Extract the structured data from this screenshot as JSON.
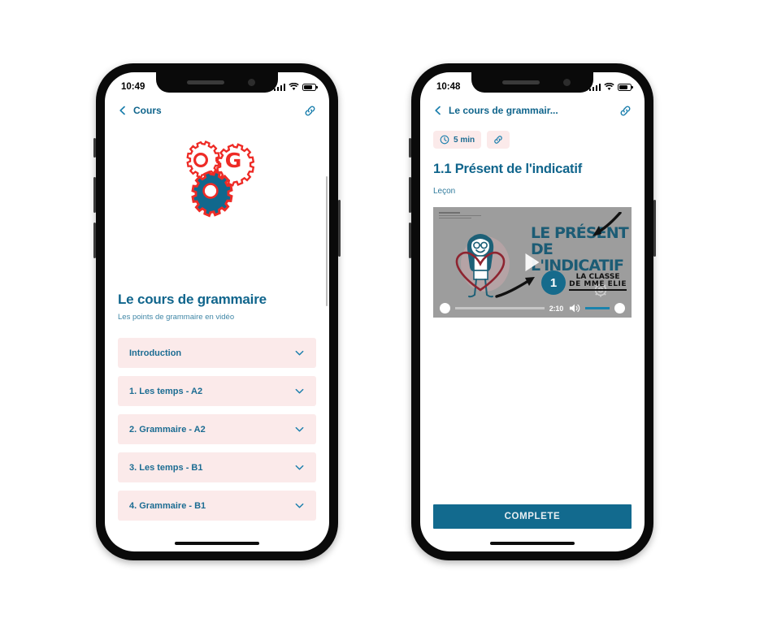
{
  "phones": {
    "left": {
      "status": {
        "time": "10:49",
        "signal_icon": "signal-bars-icon",
        "wifi_icon": "wifi-icon",
        "battery_icon": "battery-icon"
      },
      "nav": {
        "back_icon": "chevron-left-icon",
        "title": "Cours",
        "link_icon": "link-icon"
      },
      "logo": {
        "name": "gears-logo",
        "letter": "G",
        "color_outline": "#ee2b26",
        "color_fill": "#11688d"
      },
      "course": {
        "title": "Le cours de grammaire",
        "subtitle": "Les points de grammaire en vidéo"
      },
      "accordion": [
        {
          "label": "Introduction",
          "chevron": "chevron-down-icon"
        },
        {
          "label": "1. Les temps - A2",
          "chevron": "chevron-down-icon"
        },
        {
          "label": "2. Grammaire - A2",
          "chevron": "chevron-down-icon"
        },
        {
          "label": "3. Les temps  - B1",
          "chevron": "chevron-down-icon"
        },
        {
          "label": "4. Grammaire - B1",
          "chevron": "chevron-down-icon"
        }
      ]
    },
    "right": {
      "status": {
        "time": "10:48",
        "signal_icon": "signal-bars-icon",
        "wifi_icon": "wifi-icon",
        "battery_icon": "battery-icon"
      },
      "nav": {
        "back_icon": "chevron-left-icon",
        "title": "Le cours de grammair...",
        "link_icon": "link-icon"
      },
      "chips": {
        "duration_icon": "clock-icon",
        "duration": "5 min",
        "link_icon": "link-icon"
      },
      "lesson": {
        "title": "1.1 Présent de l'indicatif",
        "kind": "Leçon"
      },
      "video": {
        "heading_line1": "LE PRÉSENT DE",
        "heading_line2": "L'INDICATIF",
        "badge": "1",
        "brand_line1": "LA CLASSE",
        "brand_line2": "DE MME ELIE",
        "play_icon": "play-icon",
        "time": "2:10",
        "volume_icon": "volume-icon",
        "character_icon": "girl-with-heart-illustration",
        "arrow_icons": [
          "arrow-down-left-icon",
          "arrow-up-right-icon"
        ]
      },
      "complete_button": "COMPLETE"
    }
  },
  "colors": {
    "teal": "#10658c",
    "teal_dark": "#1c5c75",
    "pink_chip": "#fbeaea",
    "red": "#ee2b26",
    "button": "#126a8e"
  }
}
